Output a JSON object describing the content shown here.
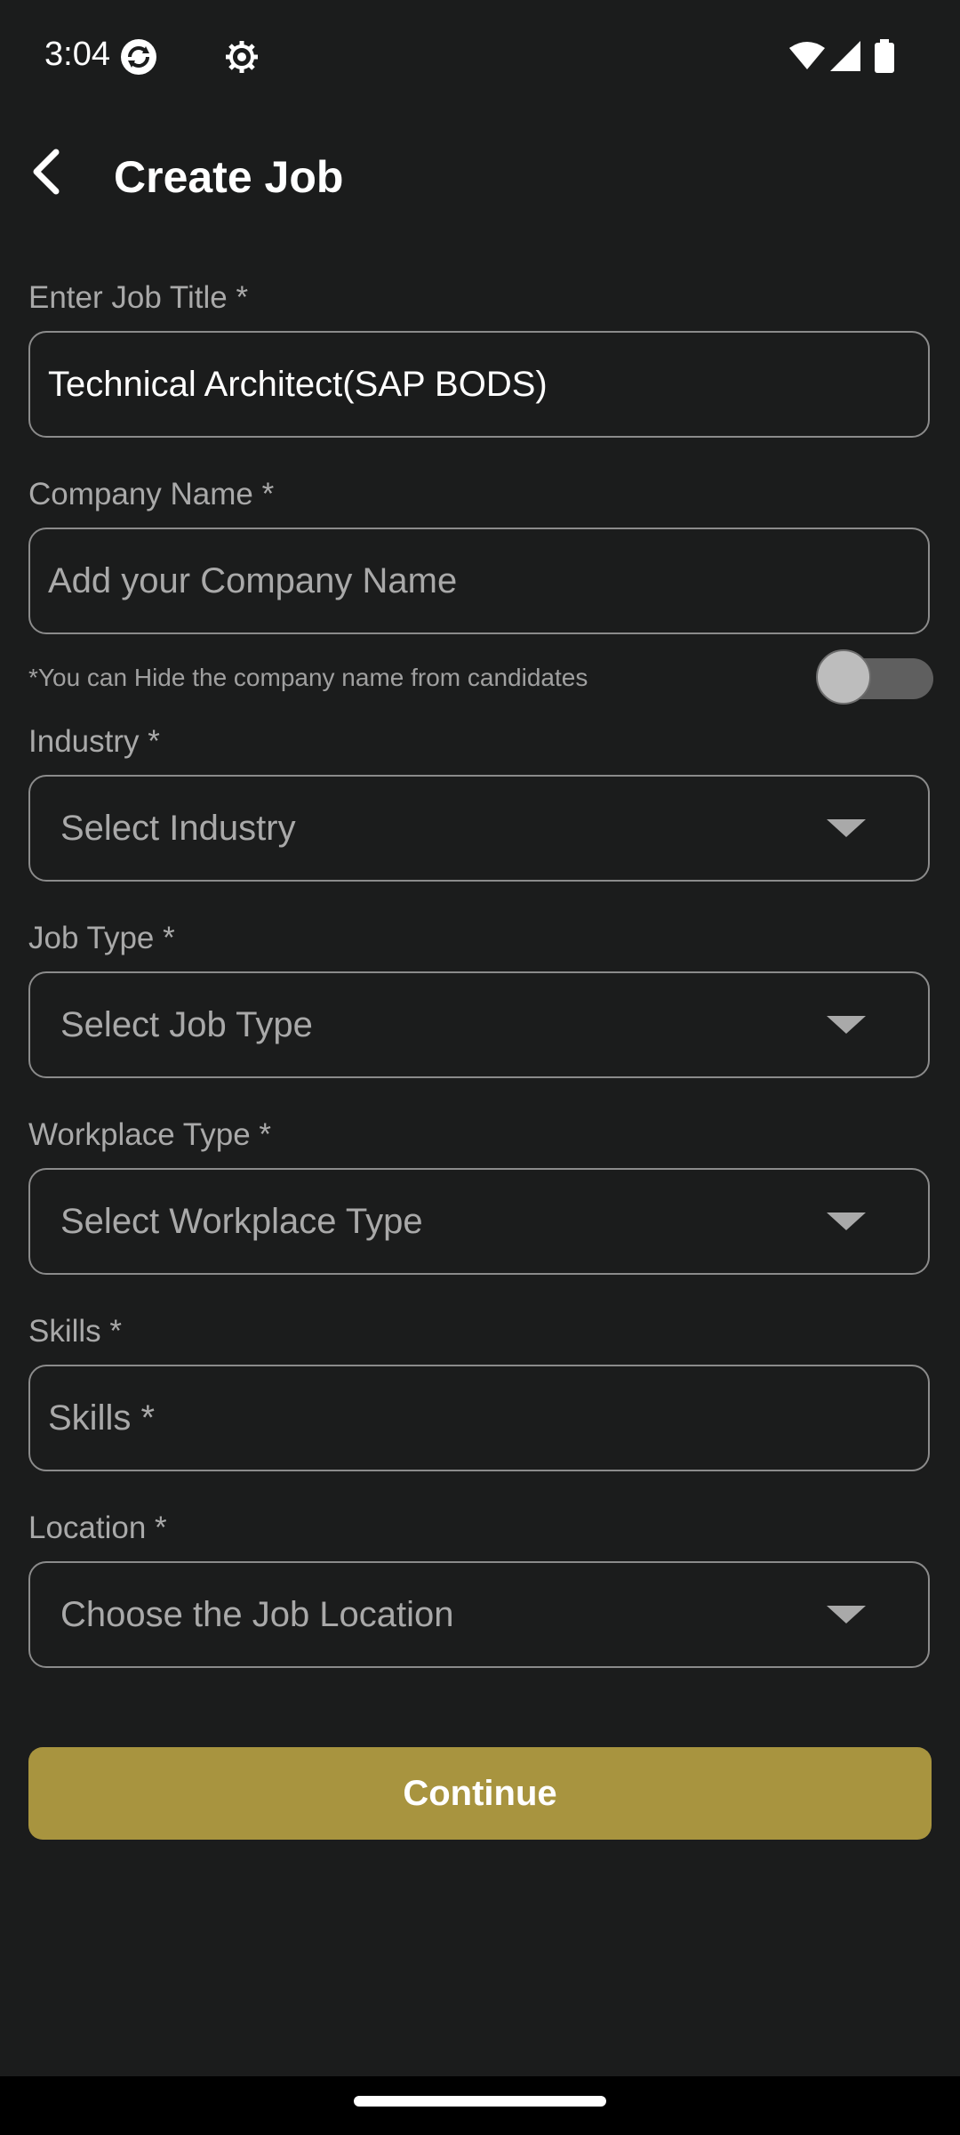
{
  "status_bar": {
    "time": "3:04",
    "icons": [
      "sync-icon",
      "gear-icon",
      "wifi-icon",
      "cell-signal-icon",
      "battery-icon"
    ]
  },
  "app_bar": {
    "title": "Create Job",
    "back_icon": "chevron-left-icon"
  },
  "form": {
    "job_title": {
      "label": "Enter Job Title *",
      "value": "Technical Architect(SAP BODS)"
    },
    "company_name": {
      "label": "Company Name *",
      "placeholder": "Add your Company Name"
    },
    "hide_company": {
      "hint": "*You can Hide the company name from candidates",
      "on": false
    },
    "industry": {
      "label": "Industry *",
      "placeholder": "Select Industry"
    },
    "job_type": {
      "label": "Job Type *",
      "placeholder": "Select Job Type"
    },
    "workplace_type": {
      "label": "Workplace Type *",
      "placeholder": "Select Workplace Type"
    },
    "skills": {
      "label": "Skills *",
      "placeholder": "Skills *"
    },
    "location": {
      "label": "Location *",
      "placeholder": "Choose the Job Location"
    }
  },
  "continue_label": "Continue",
  "colors": {
    "background": "#1b1c1c",
    "accent": "#a8943f",
    "field_border": "#8b8b8b",
    "muted_text": "#a9a9a9"
  }
}
